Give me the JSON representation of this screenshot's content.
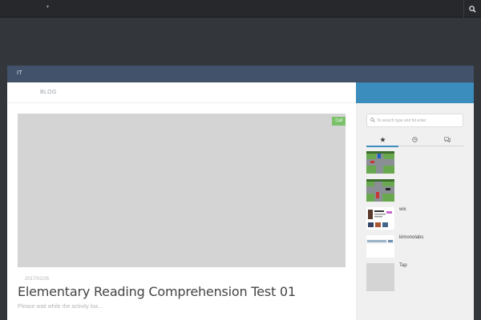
{
  "topbar": {
    "dropdown_caret": "▾",
    "search_icon": "search-icon"
  },
  "navbar": {
    "item": "IT"
  },
  "breadcrumb": {
    "label": "BLOG"
  },
  "post": {
    "category_badge": "Call",
    "date": "2017/02/26",
    "title": "Elementary Reading Comprehension Test 01",
    "excerpt": "Please wait while the activity loa..."
  },
  "sidebar": {
    "search_placeholder": "To search type and hit enter",
    "tabs": [
      {
        "icon": "star-icon",
        "active": true
      },
      {
        "icon": "clock-icon",
        "active": false
      },
      {
        "icon": "comments-icon",
        "active": false
      }
    ],
    "items": [
      {
        "label": ""
      },
      {
        "label": ""
      },
      {
        "label": "wix"
      },
      {
        "label": "kimonolabs"
      },
      {
        "label": "Tap"
      }
    ]
  },
  "colors": {
    "topbar": "#26282b",
    "header": "#33363b",
    "navbar": "#42526a",
    "sidebar_accent": "#3b8dbd",
    "badge": "#7cc26a"
  }
}
